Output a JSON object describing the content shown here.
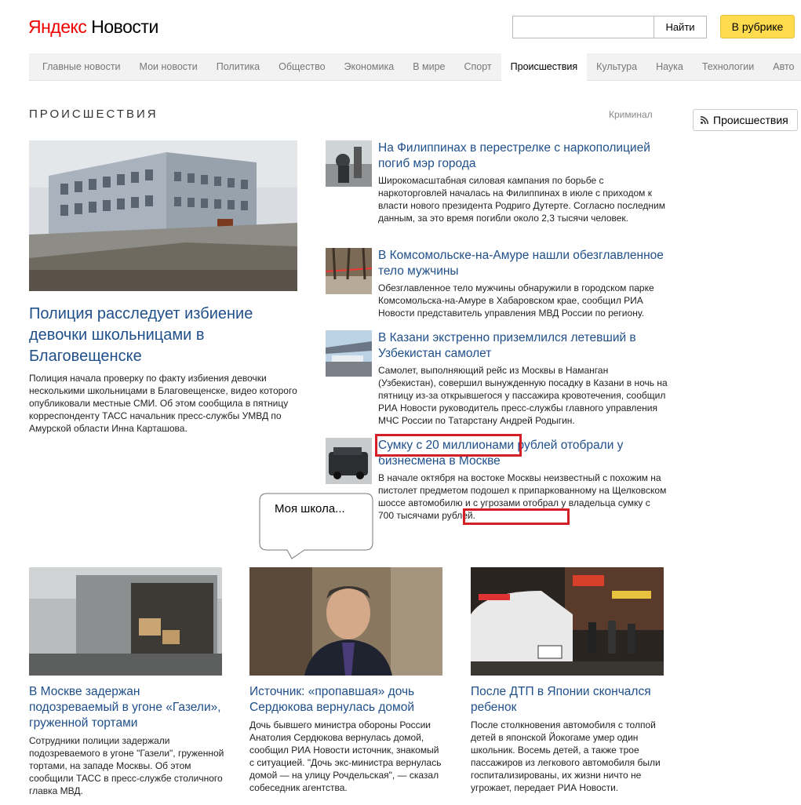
{
  "header": {
    "logo_yandex": "Яндекс",
    "logo_news": "Новости",
    "search_button": "Найти",
    "rubric_button": "В рубрике"
  },
  "nav": {
    "items": [
      "Главные новости",
      "Мои новости",
      "Политика",
      "Общество",
      "Экономика",
      "В мире",
      "Спорт",
      "Происшествия",
      "Культура",
      "Наука",
      "Технологии",
      "Авто"
    ],
    "active": "Происшествия"
  },
  "section": {
    "title": "ПРОИСШЕСТВИЯ",
    "sublink": "Криминал",
    "rss_label": "Происшествия"
  },
  "main_story": {
    "title": "Полиция расследует избиение девочки школьницами в Благовещенске",
    "text": "Полиция начала проверку по факту избиения девочки несколькими школьницами в Благовещенске, видео которого опубликовали местные СМИ. Об этом сообщила в пятницу корреспонденту ТАСС начальник пресс-службы УМВД по Амурской области Инна Карташова."
  },
  "side_stories": [
    {
      "title": "На Филиппинах в перестрелке с наркополицией погиб мэр города",
      "text": "Широкомасштабная силовая кампания по борьбе с наркоторговлей началась на Филиппинах в июле с приходом к власти нового президента Родриго Дутерте. Согласно последним данным, за это время погибли около 2,3 тысячи человек."
    },
    {
      "title": "В Комсомольске-на-Амуре нашли обезглавленное тело мужчины",
      "text": "Обезглавленное тело мужчины обнаружили в городском парке Комсомольска-на-Амуре в Хабаровском крае, сообщил РИА Новости представитель управления МВД России по региону."
    },
    {
      "title": "В Казани экстренно приземлился летевший в Узбекистан самолет",
      "text": "Самолет, выполняющий рейс из Москвы в Наманган (Узбекистан), совершил вынужденную посадку в Казани в ночь на пятницу из-за открывшегося у пассажира кровотечения, сообщил РИА Новости руководитель пресс-службы главного управления МЧС России по Татарстану Андрей Родыгин."
    },
    {
      "title": "Сумку с 20 миллионами рублей отобрали у бизнесмена в Москве",
      "text": "В начале октября на востоке Москвы неизвестный с похожим на пистолет предметом подошел к припаркованному на Щелковском шоссе автомобилю и с угрозами отобрал у владельца сумку с 700 тысячами рублей."
    }
  ],
  "annotation": {
    "bubble_text": "Моя школа..."
  },
  "bottom_stories": [
    {
      "title": "В Москве задержан подозреваемый в угоне «Газели», груженной тортами",
      "text": "Сотрудники полиции задержали подозреваемого в угоне \"Газели\", груженной тортами, на западе Москвы. Об этом сообщили ТАСС в пресс-службе столичного главка МВД."
    },
    {
      "title": "Источник: «пропавшая» дочь Сердюкова вернулась домой",
      "text": "Дочь бывшего министра обороны России Анатолия Сердюкова вернулась домой, сообщил РИА Новости источник, знакомый с ситуацией. \"Дочь экс-министра вернулась домой — на улицу Рочдельская\", — сказал собеседник агентства."
    },
    {
      "title": "После ДТП в Японии скончался ребенок",
      "text": "После столкновения автомобиля с толпой детей в японской Йокогаме умер один школьник. Восемь детей, а также трое пассажиров из легкового автомобиля были госпитализированы, их жизни ничто не угрожает, передает РИА Новости."
    }
  ],
  "colors": {
    "link": "#20508b",
    "logo_red": "#e00000",
    "highlight_red": "#d41f26",
    "button_yellow": "#ffdb4d"
  }
}
